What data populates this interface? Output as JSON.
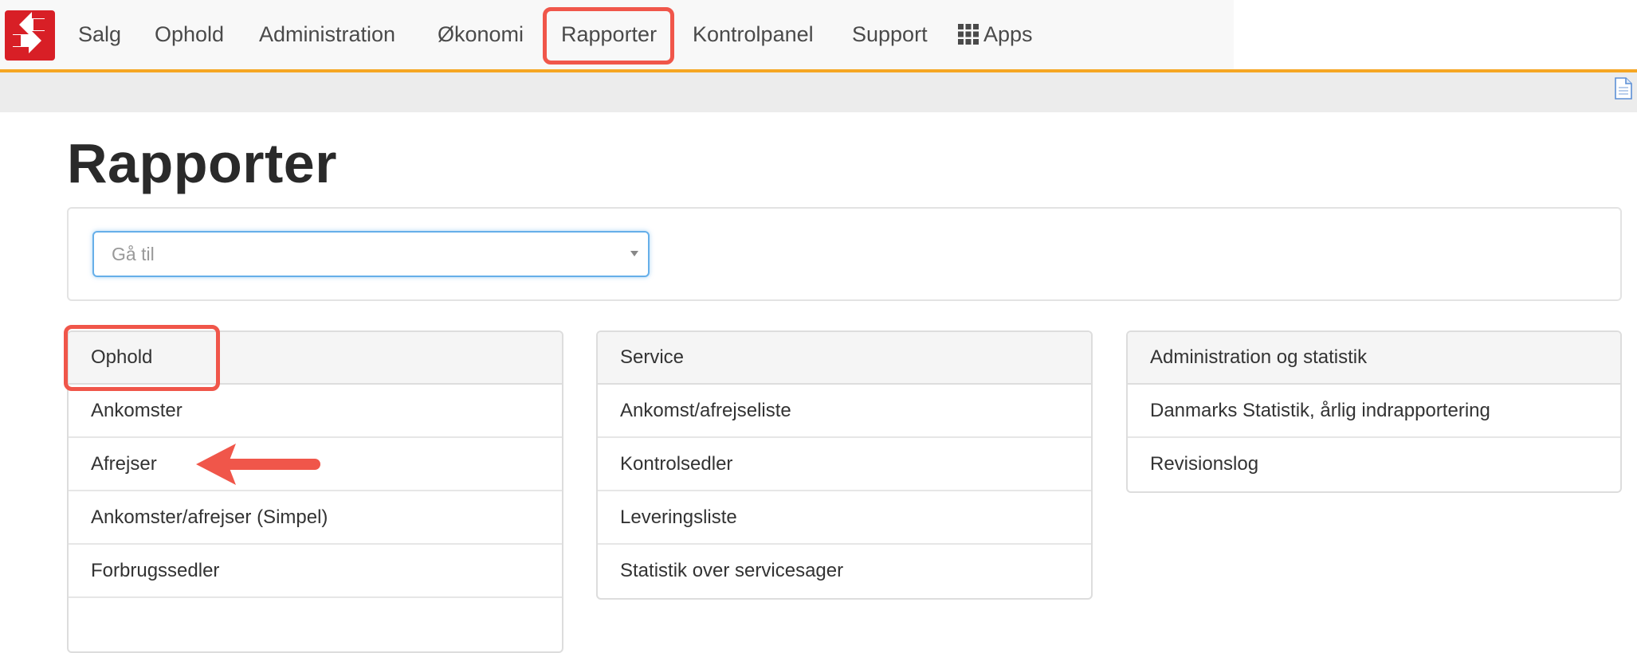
{
  "nav": {
    "items": [
      {
        "label": "Salg"
      },
      {
        "label": "Ophold"
      },
      {
        "label": "Administration"
      },
      {
        "label": "Økonomi"
      },
      {
        "label": "Rapporter"
      },
      {
        "label": "Kontrolpanel"
      },
      {
        "label": "Support"
      },
      {
        "label": "Apps"
      }
    ],
    "active": "Rapporter",
    "accent_color": "#f5a623",
    "logo_color": "#d81f26",
    "highlight_color": "#f0564a"
  },
  "page": {
    "title": "Rapporter"
  },
  "goto": {
    "placeholder": "Gå til"
  },
  "panels": [
    {
      "heading": "Ophold",
      "items": [
        "Ankomster",
        "Afrejser",
        "Ankomster/afrejser (Simpel)",
        "Forbrugssedler"
      ]
    },
    {
      "heading": "Service",
      "items": [
        "Ankomst/afrejseliste",
        "Kontrolsedler",
        "Leveringsliste",
        "Statistik over servicesager"
      ]
    },
    {
      "heading": "Administration og statistik",
      "items": [
        "Danmarks Statistik, årlig indrapportering",
        "Revisionslog"
      ]
    }
  ],
  "icons": {
    "logo": "exchange-arrows-logo",
    "apps": "grid-icon",
    "document": "document-icon"
  }
}
